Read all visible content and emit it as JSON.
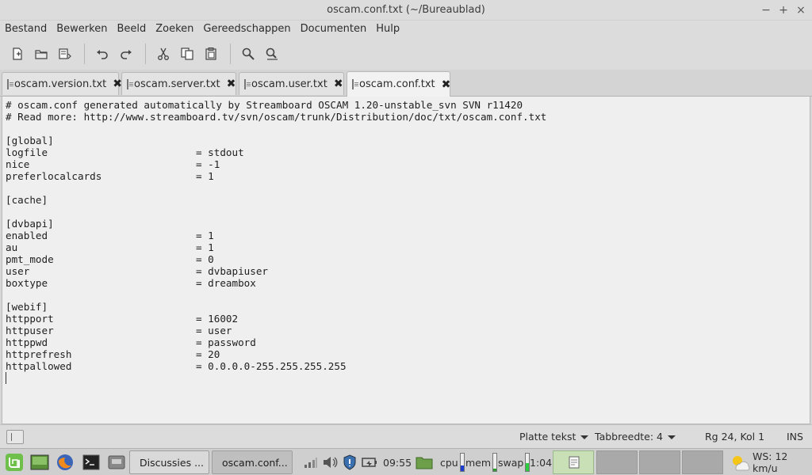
{
  "window": {
    "title": "oscam.conf.txt (~/Bureaublad)",
    "minimize": "−",
    "maximize": "+",
    "close": "×"
  },
  "menu": [
    "Bestand",
    "Bewerken",
    "Beeld",
    "Zoeken",
    "Gereedschappen",
    "Documenten",
    "Hulp"
  ],
  "toolbar_icons": [
    "new-document-icon",
    "open-icon",
    "save-icon",
    "undo-icon",
    "redo-icon",
    "cut-icon",
    "copy-icon",
    "paste-icon",
    "find-icon",
    "find-replace-icon"
  ],
  "tabs": [
    {
      "label": "oscam.version.txt",
      "close": "✖",
      "active": false
    },
    {
      "label": "oscam.server.txt",
      "close": "✖",
      "active": false
    },
    {
      "label": "oscam.user.txt",
      "close": "✖",
      "active": false
    },
    {
      "label": "oscam.conf.txt",
      "close": "✖",
      "active": true
    }
  ],
  "editor": {
    "comments": [
      "# oscam.conf generated automatically by Streamboard OSCAM 1.20-unstable_svn SVN r11420",
      "# Read more: http://www.streamboard.tv/svn/oscam/trunk/Distribution/doc/txt/oscam.conf.txt"
    ],
    "sections": {
      "global": "[global]",
      "cache": "[cache]",
      "dvbapi": "[dvbapi]",
      "webif": "[webif]"
    },
    "entries": {
      "logfile": {
        "key": "logfile",
        "value": "= stdout"
      },
      "nice": {
        "key": "nice",
        "value": "= -1"
      },
      "preferlocalcards": {
        "key": "preferlocalcards",
        "value": "= 1"
      },
      "enabled": {
        "key": "enabled",
        "value": "= 1"
      },
      "au": {
        "key": "au",
        "value": "= 1"
      },
      "pmt_mode": {
        "key": "pmt_mode",
        "value": "= 0"
      },
      "user": {
        "key": "user",
        "value": "= dvbapiuser"
      },
      "boxtype": {
        "key": "boxtype",
        "value": "= dreambox"
      },
      "httpport": {
        "key": "httpport",
        "value": "= 16002"
      },
      "httpuser": {
        "key": "httpuser",
        "value": "= user"
      },
      "httppwd": {
        "key": "httppwd",
        "value": "= password"
      },
      "httprefresh": {
        "key": "httprefresh",
        "value": "= 20"
      },
      "httpallowed": {
        "key": "httpallowed",
        "value": "= 0.0.0.0-255.255.255.255"
      }
    }
  },
  "status": {
    "syntax": "Platte tekst",
    "tabwidth": "Tabbreedte:  4",
    "position": "Rg 24, Kol 1",
    "mode": "INS"
  },
  "taskbar": {
    "tasks": [
      {
        "label": "Discussies ..."
      },
      {
        "label": "oscam.conf..."
      }
    ],
    "clock": "09:55",
    "cpu_label": "cpu",
    "mem_label": "mem",
    "swap_label": "swap",
    "uptime": "1:04",
    "weather": "WS: 12 km/u",
    "cpu_level": 0.3,
    "mem_level": 0.15,
    "swap_level": 0.45,
    "colors": {
      "cpu": "#1d3fd1",
      "mem": "#2a9d2a",
      "swap": "#2ecc40"
    }
  }
}
